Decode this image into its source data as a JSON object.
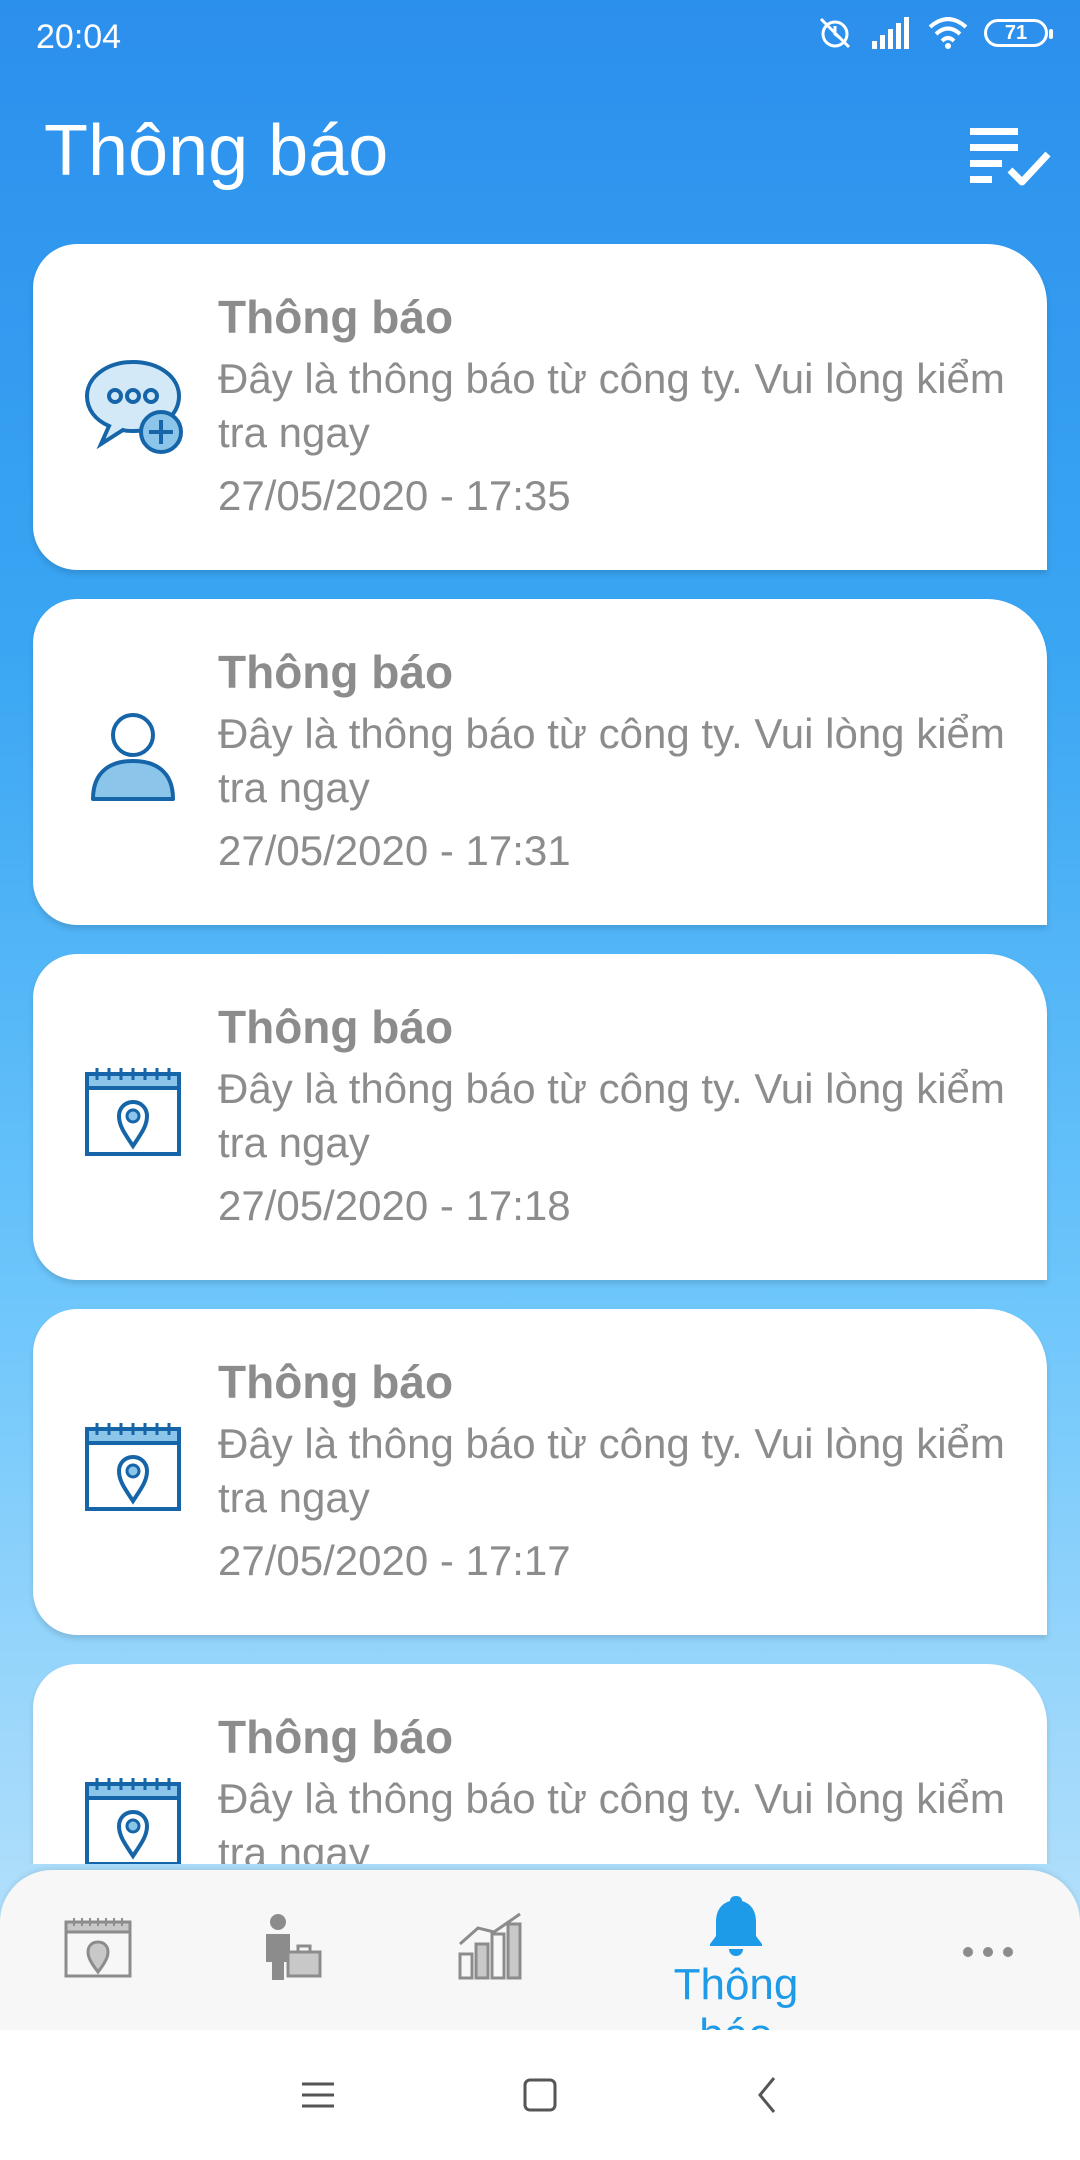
{
  "status_bar": {
    "time": "20:04",
    "battery": "71"
  },
  "header": {
    "title": "Thông báo",
    "action_icon": "mark-all-read-icon"
  },
  "notifications": [
    {
      "icon": "chat-add-icon",
      "title": "Thông báo",
      "body": "Đây là thông báo từ công ty. Vui lòng kiểm tra ngay",
      "time": "27/05/2020 - 17:35"
    },
    {
      "icon": "user-icon",
      "title": "Thông báo",
      "body": "Đây là thông báo từ công ty. Vui lòng kiểm tra ngay",
      "time": "27/05/2020 - 17:31"
    },
    {
      "icon": "calendar-location-icon",
      "title": "Thông báo",
      "body": "Đây là thông báo từ công ty. Vui lòng kiểm tra ngay",
      "time": "27/05/2020 - 17:18"
    },
    {
      "icon": "calendar-location-icon",
      "title": "Thông báo",
      "body": "Đây là thông báo từ công ty. Vui lòng kiểm tra ngay",
      "time": "27/05/2020 - 17:17"
    },
    {
      "icon": "calendar-location-icon",
      "title": "Thông báo",
      "body": "Đây là thông báo từ công ty. Vui lòng kiểm tra ngay",
      "time": ""
    }
  ],
  "bottom_nav": {
    "items": [
      {
        "icon": "calendar-location-icon"
      },
      {
        "icon": "employee-briefcase-icon"
      },
      {
        "icon": "statistics-chart-icon"
      },
      {
        "icon": "bell-icon",
        "label": "Thông báo",
        "active": true
      },
      {
        "icon": "more-icon"
      }
    ]
  },
  "colors": {
    "accent": "#1e9be8",
    "text_muted": "#8c8c8c",
    "icon_blue": "#1565a8"
  }
}
